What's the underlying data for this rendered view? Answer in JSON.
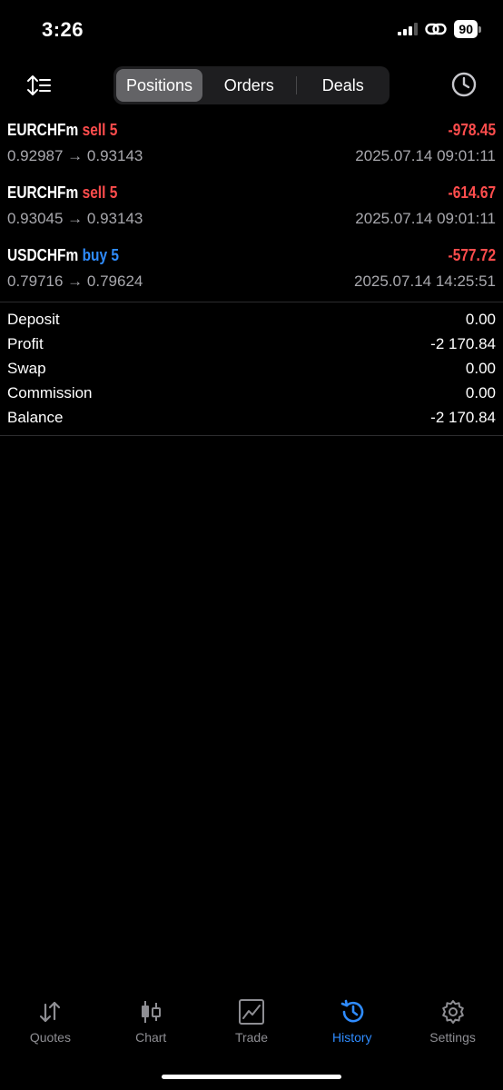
{
  "status_bar": {
    "time": "3:26",
    "battery": "90"
  },
  "toolbar": {
    "tabs": [
      {
        "label": "Positions",
        "active": true
      },
      {
        "label": "Orders",
        "active": false
      },
      {
        "label": "Deals",
        "active": false
      }
    ]
  },
  "positions": [
    {
      "symbol": "EURCHFm",
      "side": "sell 5",
      "profit": "-978.45",
      "prices": "0.92987 → 0.93143",
      "time": "2025.07.14 09:01:11"
    },
    {
      "symbol": "EURCHFm",
      "side": "sell 5",
      "profit": "-614.67",
      "prices": "0.93045 → 0.93143",
      "time": "2025.07.14 09:01:11"
    },
    {
      "symbol": "USDCHFm",
      "side": "buy 5",
      "profit": "-577.72",
      "prices": "0.79716 → 0.79624",
      "time": "2025.07.14 14:25:51"
    }
  ],
  "summary": {
    "deposit": {
      "label": "Deposit",
      "value": "0.00"
    },
    "profit": {
      "label": "Profit",
      "value": "-2 170.84"
    },
    "swap": {
      "label": "Swap",
      "value": "0.00"
    },
    "commission": {
      "label": "Commission",
      "value": "0.00"
    },
    "balance": {
      "label": "Balance",
      "value": "-2 170.84"
    }
  },
  "tabbar": {
    "quotes": "Quotes",
    "chart": "Chart",
    "trade": "Trade",
    "history": "History",
    "settings": "Settings"
  },
  "colors": {
    "sell": "#ff4d4d",
    "buy": "#2f8cff",
    "loss": "#ff4d4d",
    "active_tab": "#2f8cff"
  }
}
